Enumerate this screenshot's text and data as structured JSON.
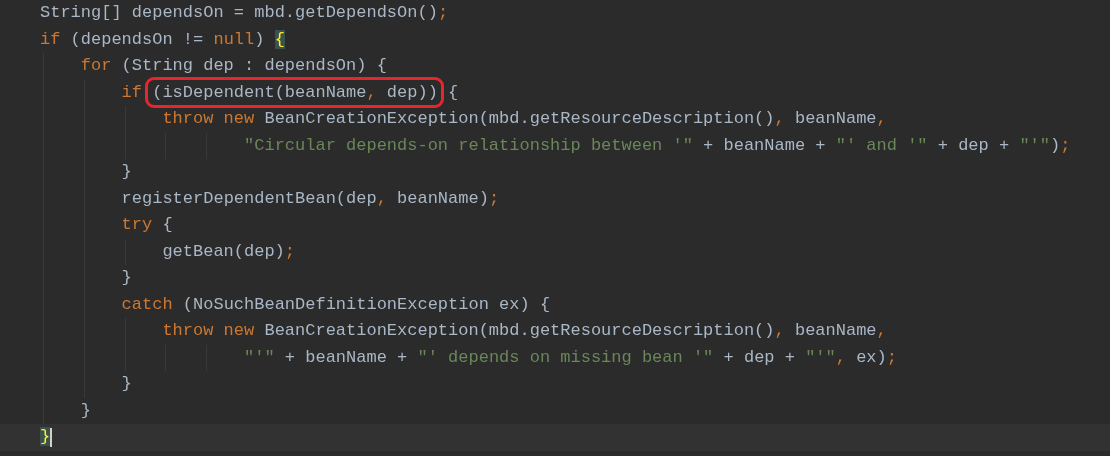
{
  "editor": {
    "lines": [
      {
        "kind": "code",
        "current": false,
        "tokens": [
          {
            "kind": "plain",
            "text": "String[] dependsOn = mbd.getDependsOn()"
          },
          {
            "kind": "punct",
            "text": ";"
          }
        ]
      },
      {
        "kind": "code",
        "current": false,
        "tokens": [
          {
            "kind": "keyword",
            "text": "if"
          },
          {
            "kind": "plain",
            "text": " (dependsOn != "
          },
          {
            "kind": "keyword",
            "text": "null"
          },
          {
            "kind": "plain",
            "text": ") "
          },
          {
            "kind": "brace",
            "text": "{",
            "matched": true
          }
        ],
        "children": [
          {
            "kind": "code",
            "current": false,
            "tokens": [
              {
                "kind": "keyword",
                "text": "for"
              },
              {
                "kind": "plain",
                "text": " (String dep : dependsOn) {"
              }
            ],
            "children": [
              {
                "kind": "code",
                "current": false,
                "tokens": [
                  {
                    "kind": "keyword",
                    "text": "if "
                  },
                  {
                    "kind": "boxed",
                    "tokens": [
                      {
                        "kind": "plain",
                        "text": "(isDependent(beanName"
                      },
                      {
                        "kind": "punct",
                        "text": ","
                      },
                      {
                        "kind": "plain",
                        "text": " dep))"
                      }
                    ]
                  },
                  {
                    "kind": "plain",
                    "text": " {"
                  }
                ],
                "children": [
                  {
                    "kind": "code",
                    "current": false,
                    "tokens": [
                      {
                        "kind": "keyword",
                        "text": "throw new"
                      },
                      {
                        "kind": "plain",
                        "text": " BeanCreationException(mbd.getResourceDescription()"
                      },
                      {
                        "kind": "punct",
                        "text": ","
                      },
                      {
                        "kind": "plain",
                        "text": " beanName"
                      },
                      {
                        "kind": "punct",
                        "text": ","
                      }
                    ],
                    "children": [
                      {
                        "kind": "continuation",
                        "current": false,
                        "tokens": [
                          {
                            "kind": "string",
                            "text": "\"Circular depends-on relationship between '\""
                          },
                          {
                            "kind": "plain",
                            "text": " + beanName + "
                          },
                          {
                            "kind": "string",
                            "text": "\"' and '\""
                          },
                          {
                            "kind": "plain",
                            "text": " + dep + "
                          },
                          {
                            "kind": "string",
                            "text": "\"'\""
                          },
                          {
                            "kind": "plain",
                            "text": ")"
                          },
                          {
                            "kind": "punct",
                            "text": ";"
                          }
                        ]
                      }
                    ]
                  }
                ]
              },
              {
                "kind": "code",
                "current": false,
                "tokens": [
                  {
                    "kind": "plain",
                    "text": "}"
                  }
                ]
              },
              {
                "kind": "code",
                "current": false,
                "tokens": [
                  {
                    "kind": "plain",
                    "text": "registerDependentBean(dep"
                  },
                  {
                    "kind": "punct",
                    "text": ","
                  },
                  {
                    "kind": "plain",
                    "text": " beanName)"
                  },
                  {
                    "kind": "punct",
                    "text": ";"
                  }
                ]
              },
              {
                "kind": "code",
                "current": false,
                "tokens": [
                  {
                    "kind": "keyword",
                    "text": "try"
                  },
                  {
                    "kind": "plain",
                    "text": " {"
                  }
                ],
                "children": [
                  {
                    "kind": "code",
                    "current": false,
                    "tokens": [
                      {
                        "kind": "plain",
                        "text": "getBean(dep)"
                      },
                      {
                        "kind": "punct",
                        "text": ";"
                      }
                    ]
                  }
                ]
              },
              {
                "kind": "code",
                "current": false,
                "tokens": [
                  {
                    "kind": "plain",
                    "text": "}"
                  }
                ]
              },
              {
                "kind": "code",
                "current": false,
                "tokens": [
                  {
                    "kind": "keyword",
                    "text": "catch"
                  },
                  {
                    "kind": "plain",
                    "text": " (NoSuchBeanDefinitionException ex) {"
                  }
                ],
                "children": [
                  {
                    "kind": "code",
                    "current": false,
                    "tokens": [
                      {
                        "kind": "keyword",
                        "text": "throw new"
                      },
                      {
                        "kind": "plain",
                        "text": " BeanCreationException(mbd.getResourceDescription()"
                      },
                      {
                        "kind": "punct",
                        "text": ","
                      },
                      {
                        "kind": "plain",
                        "text": " beanName"
                      },
                      {
                        "kind": "punct",
                        "text": ","
                      }
                    ],
                    "children": [
                      {
                        "kind": "continuation",
                        "current": false,
                        "tokens": [
                          {
                            "kind": "string",
                            "text": "\"'\""
                          },
                          {
                            "kind": "plain",
                            "text": " + beanName + "
                          },
                          {
                            "kind": "string",
                            "text": "\"' depends on missing bean '\""
                          },
                          {
                            "kind": "plain",
                            "text": " + dep + "
                          },
                          {
                            "kind": "string",
                            "text": "\"'\""
                          },
                          {
                            "kind": "punct",
                            "text": ","
                          },
                          {
                            "kind": "plain",
                            "text": " ex)"
                          },
                          {
                            "kind": "punct",
                            "text": ";"
                          }
                        ]
                      }
                    ]
                  }
                ]
              },
              {
                "kind": "code",
                "current": false,
                "tokens": [
                  {
                    "kind": "plain",
                    "text": "}"
                  }
                ]
              }
            ]
          },
          {
            "kind": "code",
            "current": false,
            "tokens": [
              {
                "kind": "plain",
                "text": "}"
              }
            ]
          }
        ]
      },
      {
        "kind": "code",
        "current": true,
        "tokens": [
          {
            "kind": "brace",
            "text": "}",
            "matched": true
          }
        ]
      }
    ]
  }
}
